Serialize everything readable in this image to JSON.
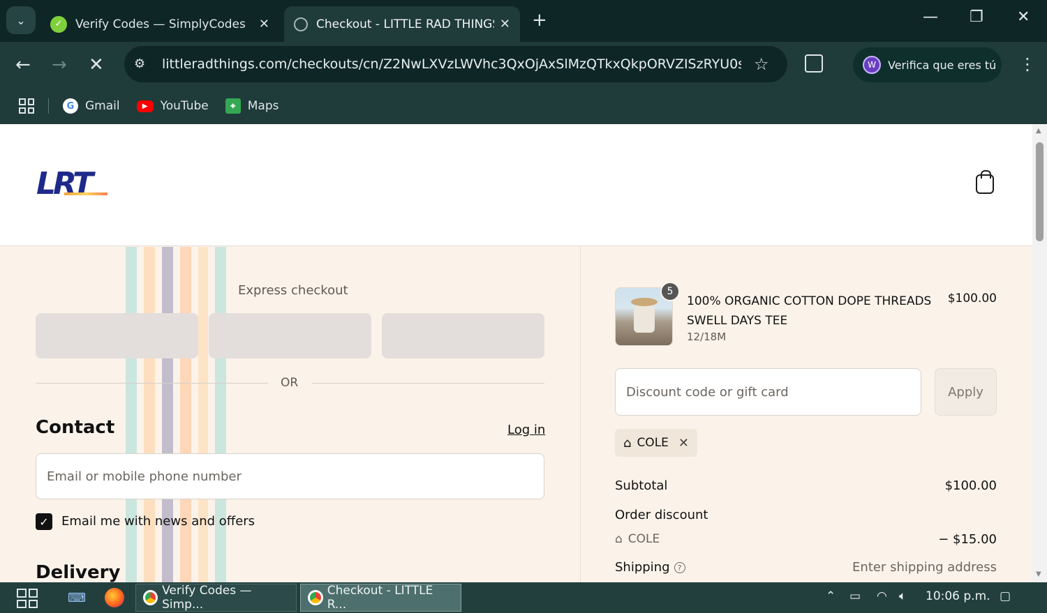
{
  "browser": {
    "tabs": [
      {
        "title": "Verify Codes — SimplyCodes",
        "active": false
      },
      {
        "title": "Checkout - LITTLE RAD THINGS",
        "active": true
      }
    ],
    "url": "littleradthings.com/checkouts/cn/Z2NwLXVzLWVhc3QxOjAxSlMzQTkxQkpORVZISzRYU0sw...",
    "profile_label": "Verifica que eres tú",
    "profile_initial": "W",
    "bookmarks": [
      "Gmail",
      "YouTube",
      "Maps"
    ]
  },
  "shop": {
    "logo_text": "LRT"
  },
  "checkout": {
    "express_label": "Express checkout",
    "or_label": "OR",
    "contact_title": "Contact",
    "login_label": "Log in",
    "email_placeholder": "Email or mobile phone number",
    "newsletter_label": "Email me with news and offers",
    "newsletter_checked": true,
    "delivery_title": "Delivery"
  },
  "summary": {
    "product": {
      "name": "100% ORGANIC COTTON DOPE THREADS SWELL DAYS TEE",
      "variant": "12/18M",
      "price": "$100.00",
      "quantity": "5"
    },
    "discount_placeholder": "Discount code or gift card",
    "apply_label": "Apply",
    "applied_code": "COLE",
    "subtotal_label": "Subtotal",
    "subtotal_value": "$100.00",
    "order_discount_label": "Order discount",
    "discount_code": "COLE",
    "discount_value": "− $15.00",
    "shipping_label": "Shipping",
    "shipping_value": "Enter shipping address"
  },
  "taskbar": {
    "apps": [
      "Verify Codes — Simp...",
      "Checkout - LITTLE R..."
    ],
    "time": "10:06 p.m."
  },
  "colors": {
    "chrome_dark": "#0f2626",
    "chrome": "#1f3b3a",
    "page_bg": "#fbf3ea",
    "logo_blue": "#1e2a8a"
  }
}
